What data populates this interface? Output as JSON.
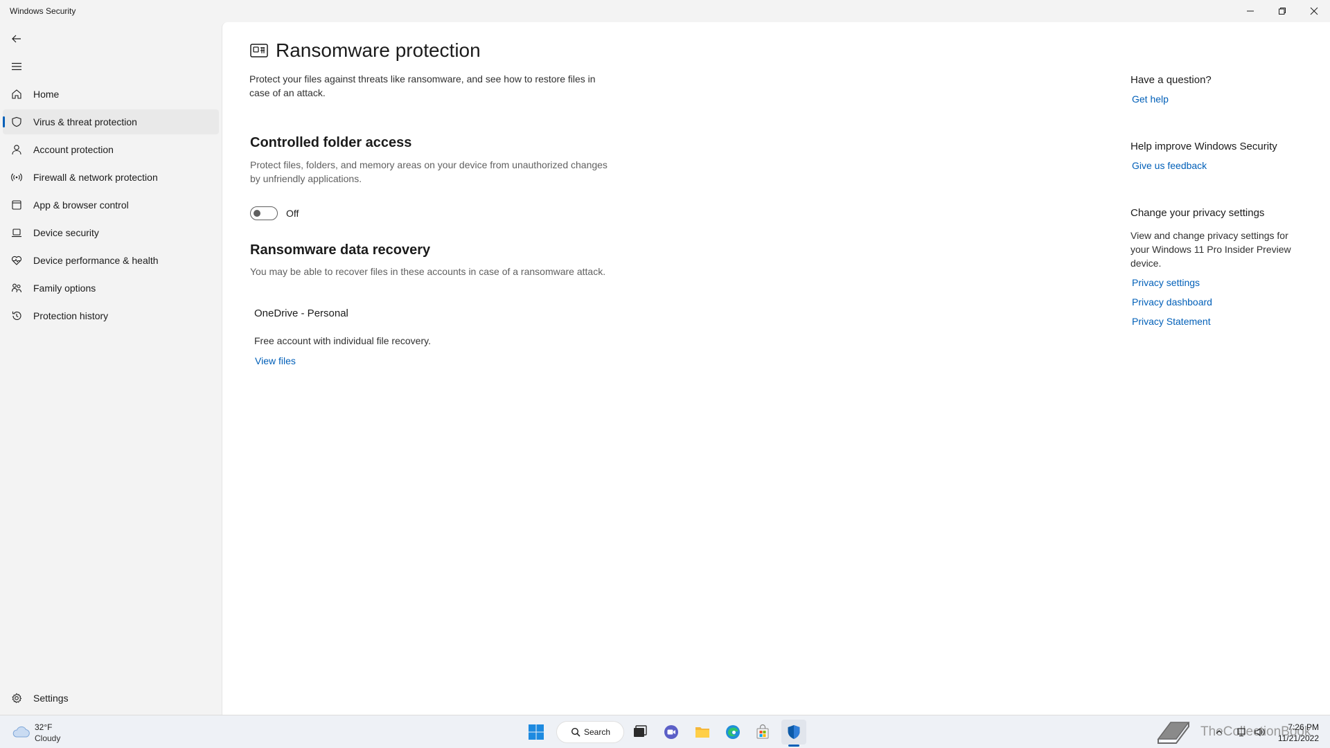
{
  "window": {
    "title": "Windows Security"
  },
  "sidebar": {
    "items": [
      {
        "label": "Home",
        "icon": "home-icon"
      },
      {
        "label": "Virus & threat protection",
        "icon": "shield-icon",
        "active": true
      },
      {
        "label": "Account protection",
        "icon": "person-icon"
      },
      {
        "label": "Firewall & network protection",
        "icon": "wifi-icon"
      },
      {
        "label": "App & browser control",
        "icon": "browser-icon"
      },
      {
        "label": "Device security",
        "icon": "laptop-icon"
      },
      {
        "label": "Device performance & health",
        "icon": "heart-icon"
      },
      {
        "label": "Family options",
        "icon": "family-icon"
      },
      {
        "label": "Protection history",
        "icon": "history-icon"
      }
    ],
    "settings_label": "Settings"
  },
  "main": {
    "title": "Ransomware protection",
    "description": "Protect your files against threats like ransomware, and see how to restore files in case of an attack.",
    "controlled_folder": {
      "title": "Controlled folder access",
      "description": "Protect files, folders, and memory areas on your device from unauthorized changes by unfriendly applications.",
      "toggle_state": "Off"
    },
    "recovery": {
      "title": "Ransomware data recovery",
      "description": "You may be able to recover files in these accounts in case of a ransomware attack.",
      "account_name": "OneDrive - Personal",
      "account_desc": "Free account with individual file recovery.",
      "view_files": "View files"
    }
  },
  "side_panel": {
    "question": {
      "heading": "Have a question?",
      "link": "Get help"
    },
    "improve": {
      "heading": "Help improve Windows Security",
      "link": "Give us feedback"
    },
    "privacy": {
      "heading": "Change your privacy settings",
      "text": "View and change privacy settings for your Windows 11 Pro Insider Preview device.",
      "links": [
        "Privacy settings",
        "Privacy dashboard",
        "Privacy Statement"
      ]
    }
  },
  "taskbar": {
    "weather": {
      "temp": "32°F",
      "condition": "Cloudy"
    },
    "search_label": "Search",
    "clock": {
      "time": "7:26 PM",
      "date": "11/21/2022"
    },
    "watermark": "TheCollectionBook"
  },
  "colors": {
    "accent": "#005fb8",
    "sidebar_bg": "#f3f3f3",
    "content_bg": "#ffffff"
  }
}
